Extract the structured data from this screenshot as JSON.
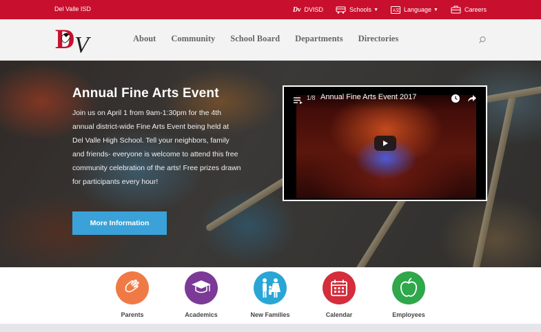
{
  "topbar": {
    "brand": "Del Valle ISD",
    "links": [
      {
        "label": "DVISD",
        "icon": "dv-logo-icon"
      },
      {
        "label": "Schools",
        "icon": "school-bus-icon",
        "dropdown": true
      },
      {
        "label": "Language",
        "icon": "language-icon",
        "dropdown": true
      },
      {
        "label": "Careers",
        "icon": "briefcase-icon"
      }
    ],
    "bg": "#c8102e"
  },
  "header": {
    "logo_text": "DV",
    "nav": [
      "About",
      "Community",
      "School Board",
      "Departments",
      "Directories"
    ],
    "search_icon": "search-icon"
  },
  "hero": {
    "title": "Annual Fine Arts Event",
    "text": "Join us on April 1 from 9am-1:30pm for the 4th annual district-wide Fine Arts Event being held at Del Valle High School.  Tell your neighbors, family and friends- everyone is welcome to attend this free community celebration of the arts! Free prizes drawn for participants every hour!",
    "button": "More Information",
    "button_color": "#3aa2d8"
  },
  "video": {
    "counter": "1/8",
    "title": "Annual Fine Arts Event 2017"
  },
  "quick_links": [
    {
      "label": "Parents",
      "color": "#f07a45",
      "icon": "hands-icon"
    },
    {
      "label": "Academics",
      "color": "#7b3a96",
      "icon": "graduation-cap-icon"
    },
    {
      "label": "New Families",
      "color": "#2aa6d6",
      "icon": "family-icon"
    },
    {
      "label": "Calendar",
      "color": "#d42d3c",
      "icon": "calendar-icon"
    },
    {
      "label": "Employees",
      "color": "#2ea84a",
      "icon": "apple-icon"
    }
  ]
}
